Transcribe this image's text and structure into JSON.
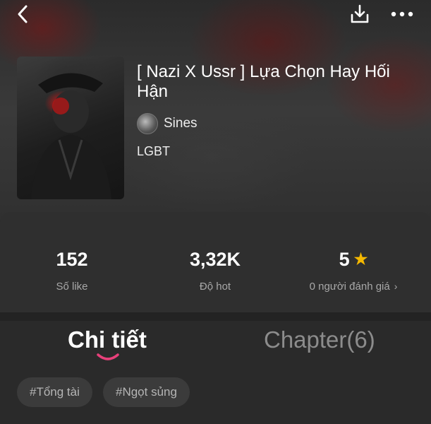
{
  "story": {
    "title": "[ Nazi X Ussr ] Lựa Chọn Hay Hối Hận",
    "author": "Sines",
    "genre": "LGBT"
  },
  "stats": {
    "likes": {
      "value": "152",
      "label": "Số like"
    },
    "hot": {
      "value": "3,32K",
      "label": "Độ hot"
    },
    "rating": {
      "value": "5",
      "label": "0 người đánh giá"
    }
  },
  "tabs": {
    "detail": "Chi tiết",
    "chapter": "Chapter(6)"
  },
  "tags": [
    "#Tổng tài",
    "#Ngọt sủng"
  ],
  "icons": {
    "back": "chevron-left-icon",
    "download": "download-icon",
    "more": "more-horizontal-icon",
    "star": "star-icon"
  },
  "colors": {
    "accent": "#e8407a",
    "star": "#f5b800",
    "background": "#2a2a2a"
  }
}
